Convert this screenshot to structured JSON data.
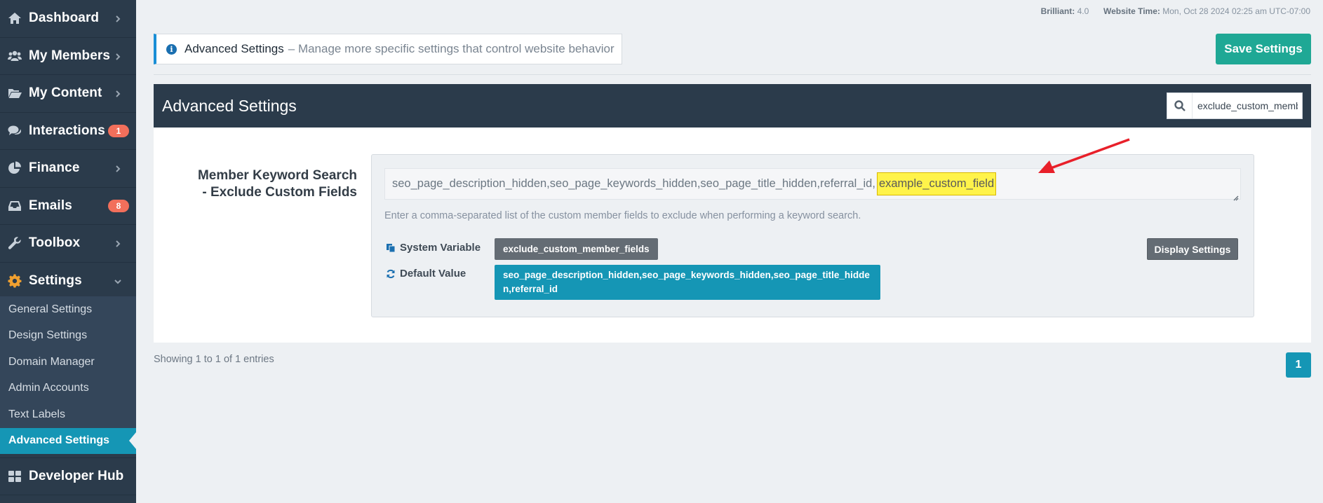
{
  "sidebar": {
    "items": [
      {
        "label": "Dashboard",
        "icon": "home-icon"
      },
      {
        "label": "My Members",
        "icon": "users-icon"
      },
      {
        "label": "My Content",
        "icon": "folder-open-icon"
      },
      {
        "label": "Interactions",
        "icon": "comments-icon",
        "badge": "1"
      },
      {
        "label": "Finance",
        "icon": "pie-chart-icon"
      },
      {
        "label": "Emails",
        "icon": "inbox-icon",
        "badge": "8"
      },
      {
        "label": "Toolbox",
        "icon": "wrench-icon"
      },
      {
        "label": "Settings",
        "icon": "gear-icon"
      }
    ],
    "settings_sub": [
      "General Settings",
      "Design Settings",
      "Domain Manager",
      "Admin Accounts",
      "Text Labels",
      "Advanced Settings"
    ],
    "active_sub": "Advanced Settings",
    "developer_hub": "Developer Hub"
  },
  "topbar": {
    "theme_key": "Brilliant:",
    "theme_value": "4.0",
    "time_key": "Website Time:",
    "time_value": "Mon, Oct 28 2024 02:25 am UTC-07:00"
  },
  "info_banner": {
    "title": "Advanced Settings",
    "description": "– Manage more specific settings that control website behavior"
  },
  "save_button": "Save Settings",
  "panel": {
    "title": "Advanced Settings",
    "search_value": "exclude_custom_member_fields"
  },
  "setting": {
    "label_line1": "Member Keyword Search",
    "label_line2": "- Exclude Custom Fields",
    "value_prefix": "seo_page_description_hidden,seo_page_keywords_hidden,seo_page_title_hidden,referral_id,",
    "value_highlight": "example_custom_field",
    "help_text": "Enter a comma-separated list of the custom member fields to exclude when performing a keyword search.",
    "system_variable_label": "System Variable",
    "system_variable": "exclude_custom_member_fields",
    "default_value_label": "Default Value",
    "default_value": "seo_page_description_hidden,seo_page_keywords_hidden,seo_page_title_hidden,referral_id",
    "display_button": "Display Settings"
  },
  "footer": {
    "entries": "Showing 1 to 1 of 1 entries",
    "page": "1"
  },
  "colors": {
    "sidebar_bg": "#2b3b4b",
    "accent_teal": "#1596b5",
    "save_green": "#1fa895",
    "badge_red": "#f26f5b",
    "highlight_yellow": "#fff34a",
    "annotation_arrow": "#e8202a"
  }
}
